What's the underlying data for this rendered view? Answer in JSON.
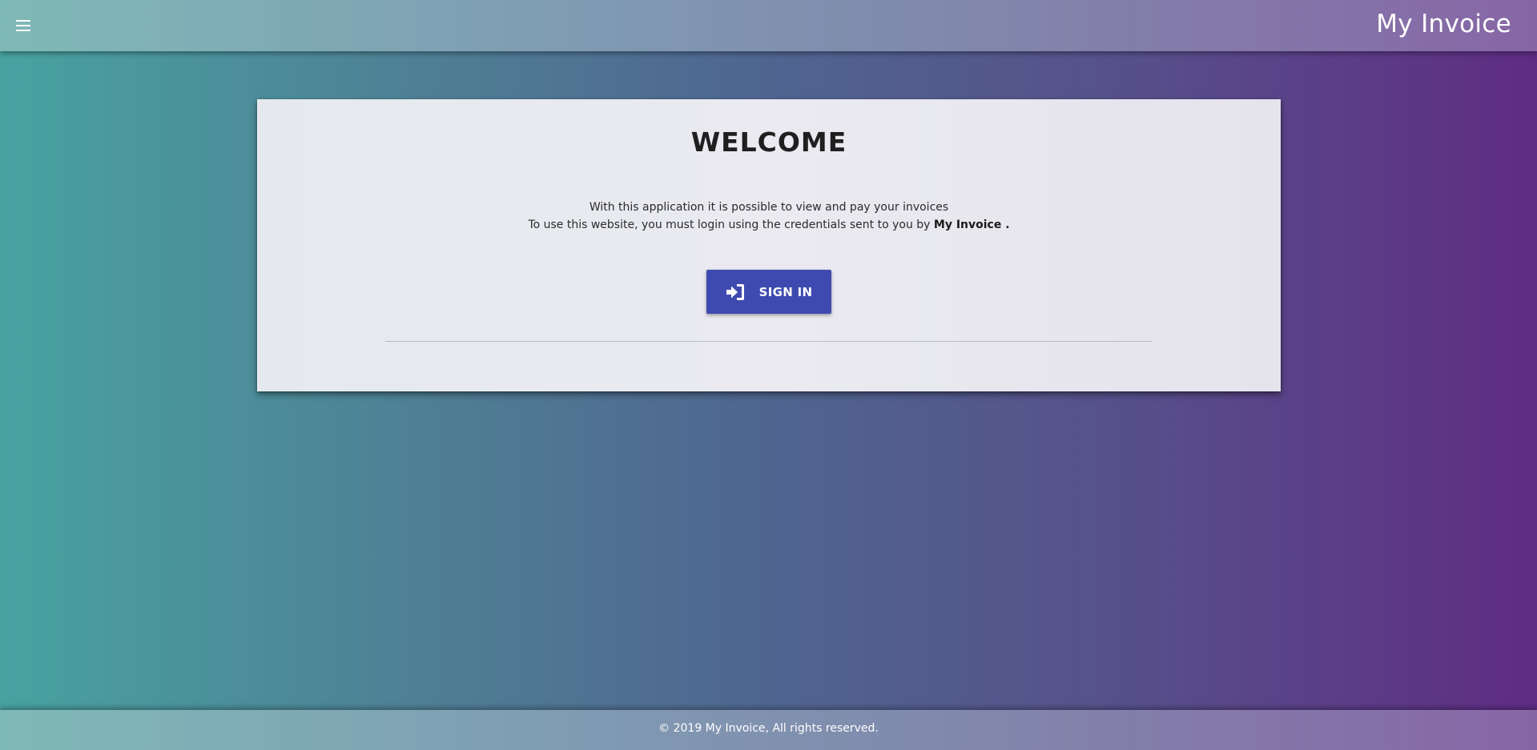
{
  "header": {
    "menu_icon": "hamburger-menu-icon",
    "title": "My Invoice"
  },
  "welcome_card": {
    "heading": "WELCOME",
    "line1": "With this application it is possible to view and pay your invoices",
    "line2_prefix": "To use this website, you must login using the credentials sent to you by ",
    "line2_brand": "My Invoice .",
    "signin_icon": "sign-in-icon",
    "signin_label": "SIGN IN"
  },
  "footer": {
    "copyright": "© 2019 My Invoice, All rights reserved."
  },
  "colors": {
    "button": "#3f4ab0",
    "gradient_start": "#48a2a0",
    "gradient_end": "#5f2c84"
  }
}
